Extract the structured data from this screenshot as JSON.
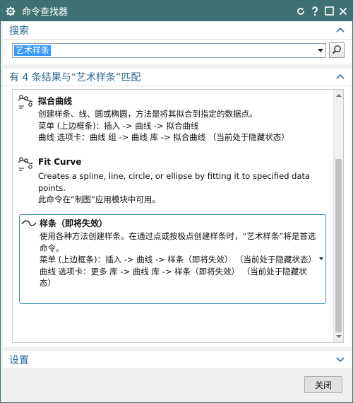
{
  "window": {
    "title": "命令查找器"
  },
  "search": {
    "header": "搜索",
    "query": "艺术样条"
  },
  "results": {
    "header": "有 4 条结果与“艺术样条”匹配",
    "items": [
      {
        "title": "拟合曲线",
        "lines": [
          "创建样条、线、圆或椭圆，方法是将其拟合到指定的数据点。",
          "菜单 (上边框条)：插入 -> 曲线 -> 拟合曲线",
          "曲线 选项卡：曲线 组 -> 曲线 库 -> 拟合曲线  （当前处于隐藏状态）"
        ]
      },
      {
        "title": "Fit Curve",
        "lines": [
          "Creates a spline, line, circle, or ellipse by fitting it to specified data",
          "points.",
          "此命令在“制图”应用模块中可用。"
        ]
      },
      {
        "title": "样条（即将失效）",
        "lines": [
          "使用各种方法创建样条。在通过点或按极点创建样条时，“艺术样条”将是首选命令。",
          "菜单 (上边框条)：插入 -> 曲线 -> 样条（即将失效）   （当前处于隐藏状态）",
          "曲线 选项卡：更多 库 -> 曲线 库 -> 样条（即将失效）   （当前处于隐藏状态）"
        ]
      }
    ]
  },
  "settings": {
    "header": "设置"
  },
  "footer": {
    "close_label": "关闭"
  },
  "colors": {
    "titlebar": "#3e7272",
    "section_header_text": "#2d6a8f",
    "selection_border": "#3d8fb0",
    "search_highlight": "#3399ff"
  }
}
